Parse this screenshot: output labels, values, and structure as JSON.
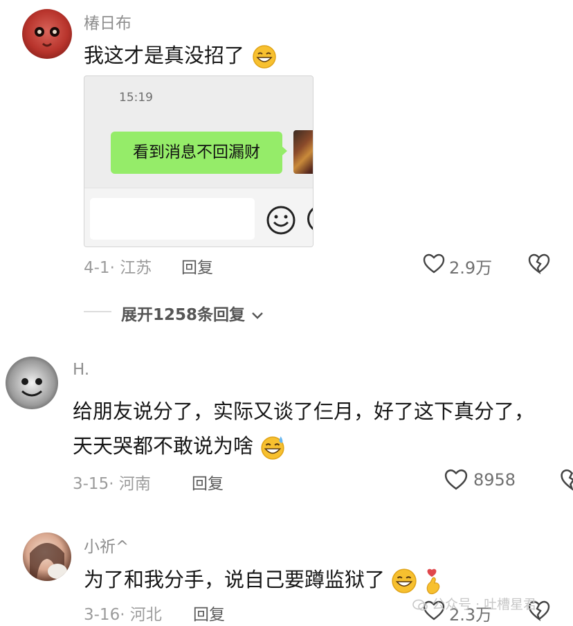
{
  "comments": [
    {
      "username": "椿日布",
      "text": "我这才是真没招了",
      "date_location": "4-1· 江苏",
      "reply_label": "回复",
      "likes": "2.9万",
      "embedded_screenshot": {
        "time": "15:19",
        "message": "看到消息不回漏财"
      },
      "expand_label": "展开1258条回复"
    },
    {
      "username": "H.",
      "text_line1": "给朋友说分了，实际又谈了仨月，好了这下真分了，",
      "text_line2": "天天哭都不敢说为啥",
      "date_location": "3-15· 河南",
      "reply_label": "回复",
      "likes": "8958"
    },
    {
      "username": "小祈^",
      "text": "为了和我分手，说自己要蹲监狱了",
      "date_location": "3-16· 河北",
      "reply_label": "回复",
      "likes": "2.3万"
    }
  ],
  "watermark": "公众号 · 吐槽星君",
  "colors": {
    "bubble_green": "#95ec69",
    "emoji_yellow": "#f7c02f"
  }
}
